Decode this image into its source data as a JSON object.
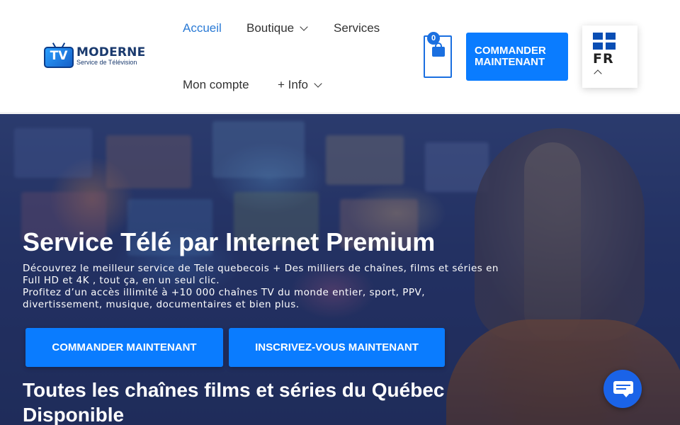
{
  "brand": {
    "tv_label": "TV",
    "name": "MODERNE",
    "tagline": "Service de Télévision"
  },
  "nav": {
    "items": [
      {
        "label": "Accueil",
        "active": true,
        "has_dropdown": false
      },
      {
        "label": "Boutique",
        "active": false,
        "has_dropdown": true
      },
      {
        "label": "Services",
        "active": false,
        "has_dropdown": false
      },
      {
        "label": "Mon compte",
        "active": false,
        "has_dropdown": false
      },
      {
        "label": "+ Info",
        "active": false,
        "has_dropdown": true
      }
    ]
  },
  "cart": {
    "count": "0",
    "icon": "shopping-bag-icon"
  },
  "header_cta": {
    "line1": "COMMANDER",
    "line2": "MAINTENANT"
  },
  "language": {
    "code": "FR",
    "flag": "quebec-flag-icon"
  },
  "hero": {
    "title": "Service Télé par Internet Premium",
    "description_1": "Découvrez le meilleur service de Tele quebecois + Des milliers de chaînes, films et séries en Full HD et 4K , tout ça, en un seul clic.",
    "description_2": "Profitez d’un accès illimité à +10 000 chaînes TV du monde entier, sport, PPV, divertissement, musique, documentaires et bien plus.",
    "cta_primary": "COMMANDER MAINTENANT",
    "cta_secondary": "INSCRIVEZ-VOUS MAINTENANT",
    "subtitle": "Toutes les chaînes films et séries du Québec Disponible"
  },
  "chat": {
    "icon": "chat-icon"
  },
  "colors": {
    "accent": "#0a7cff",
    "nav_active": "#2a7ad5",
    "hero_overlay": "#2c3c72"
  }
}
